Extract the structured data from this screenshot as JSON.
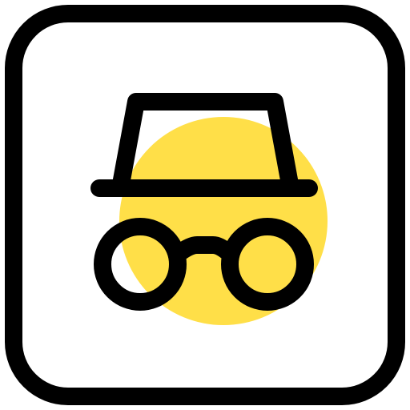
{
  "icon": {
    "name": "incognito-icon",
    "colors": {
      "stroke": "#000000",
      "accent": "#FFDF48",
      "background": "#FFFFFF"
    }
  }
}
